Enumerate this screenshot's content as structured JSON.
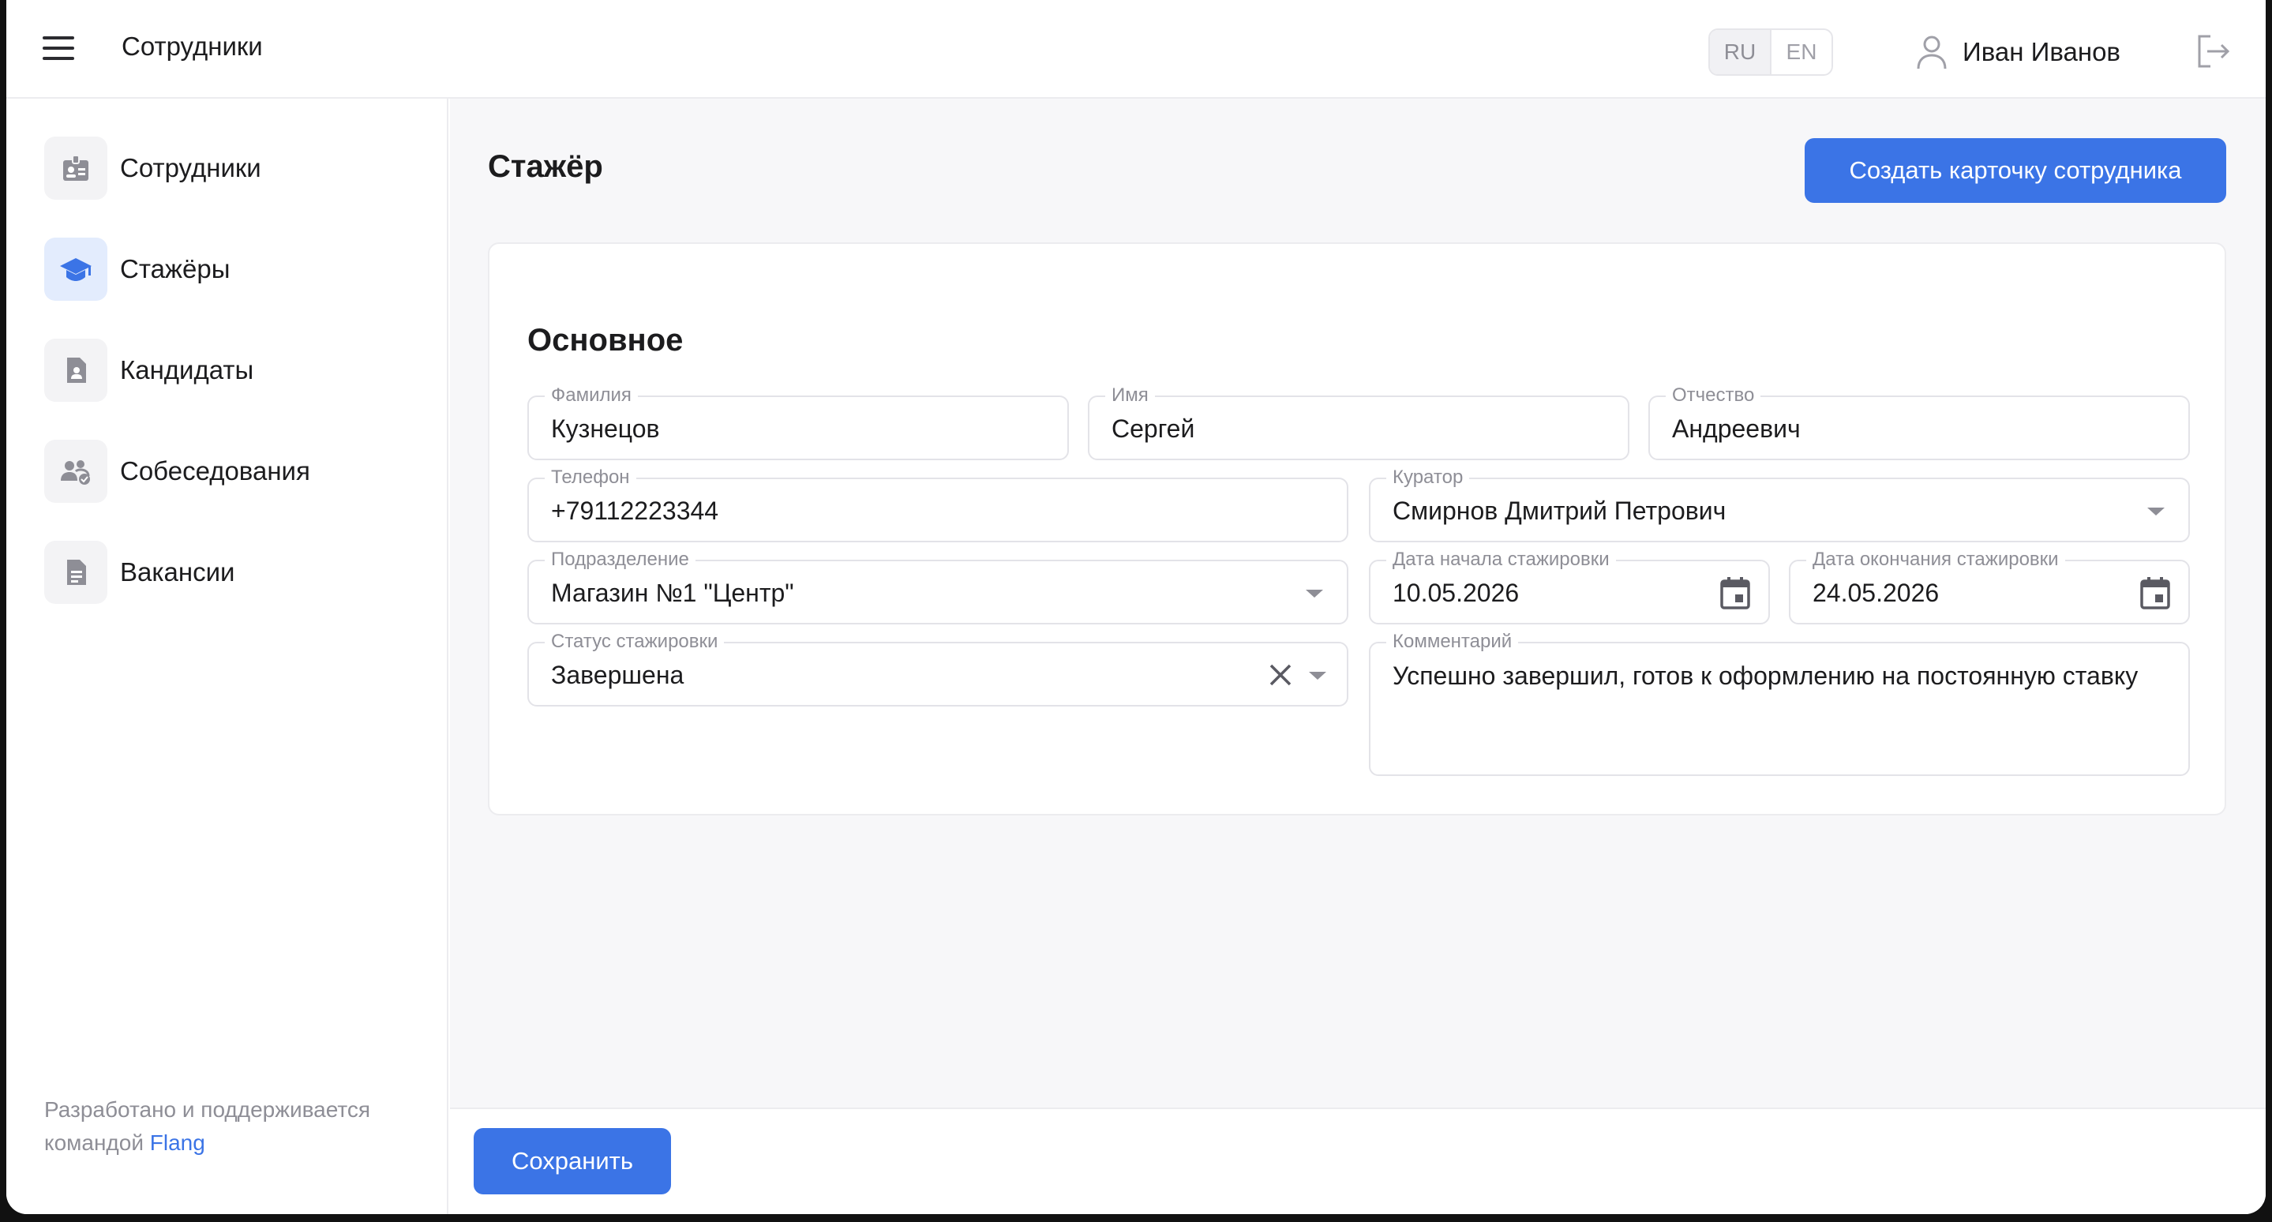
{
  "header": {
    "app_title": "Сотрудники",
    "lang": {
      "ru": "RU",
      "en": "EN",
      "active": "RU"
    },
    "user_name": "Иван Иванов"
  },
  "sidebar": {
    "items": [
      {
        "label": "Сотрудники",
        "icon": "badge-icon"
      },
      {
        "label": "Стажёры",
        "icon": "graduation-cap-icon",
        "active": true
      },
      {
        "label": "Кандидаты",
        "icon": "person-document-icon"
      },
      {
        "label": "Собеседования",
        "icon": "people-chat-icon"
      },
      {
        "label": "Вакансии",
        "icon": "document-icon"
      }
    ],
    "footer_text": "Разработано и поддерживается командой",
    "footer_link": "Flang"
  },
  "main": {
    "page_title": "Стажёр",
    "create_button": "Создать карточку сотрудника",
    "section_title": "Основное",
    "fields": {
      "last_name": {
        "label": "Фамилия",
        "value": "Кузнецов"
      },
      "first_name": {
        "label": "Имя",
        "value": "Сергей"
      },
      "patronymic": {
        "label": "Отчество",
        "value": "Андреевич"
      },
      "phone": {
        "label": "Телефон",
        "value": "+79112223344"
      },
      "curator": {
        "label": "Куратор",
        "value": "Смирнов Дмитрий Петрович"
      },
      "department": {
        "label": "Подразделение",
        "value": "Магазин №1 \"Центр\""
      },
      "start_date": {
        "label": "Дата начала стажировки",
        "value": "10.05.2026"
      },
      "end_date": {
        "label": "Дата окончания стажировки",
        "value": "24.05.2026"
      },
      "status": {
        "label": "Статус стажировки",
        "value": "Завершена"
      },
      "comment": {
        "label": "Комментарий",
        "value": "Успешно завершил, готов к оформлению на постоянную ставку"
      }
    },
    "save_button": "Сохранить"
  },
  "colors": {
    "accent": "#3b74e6",
    "active_nav_bg": "#e3ecfd"
  }
}
